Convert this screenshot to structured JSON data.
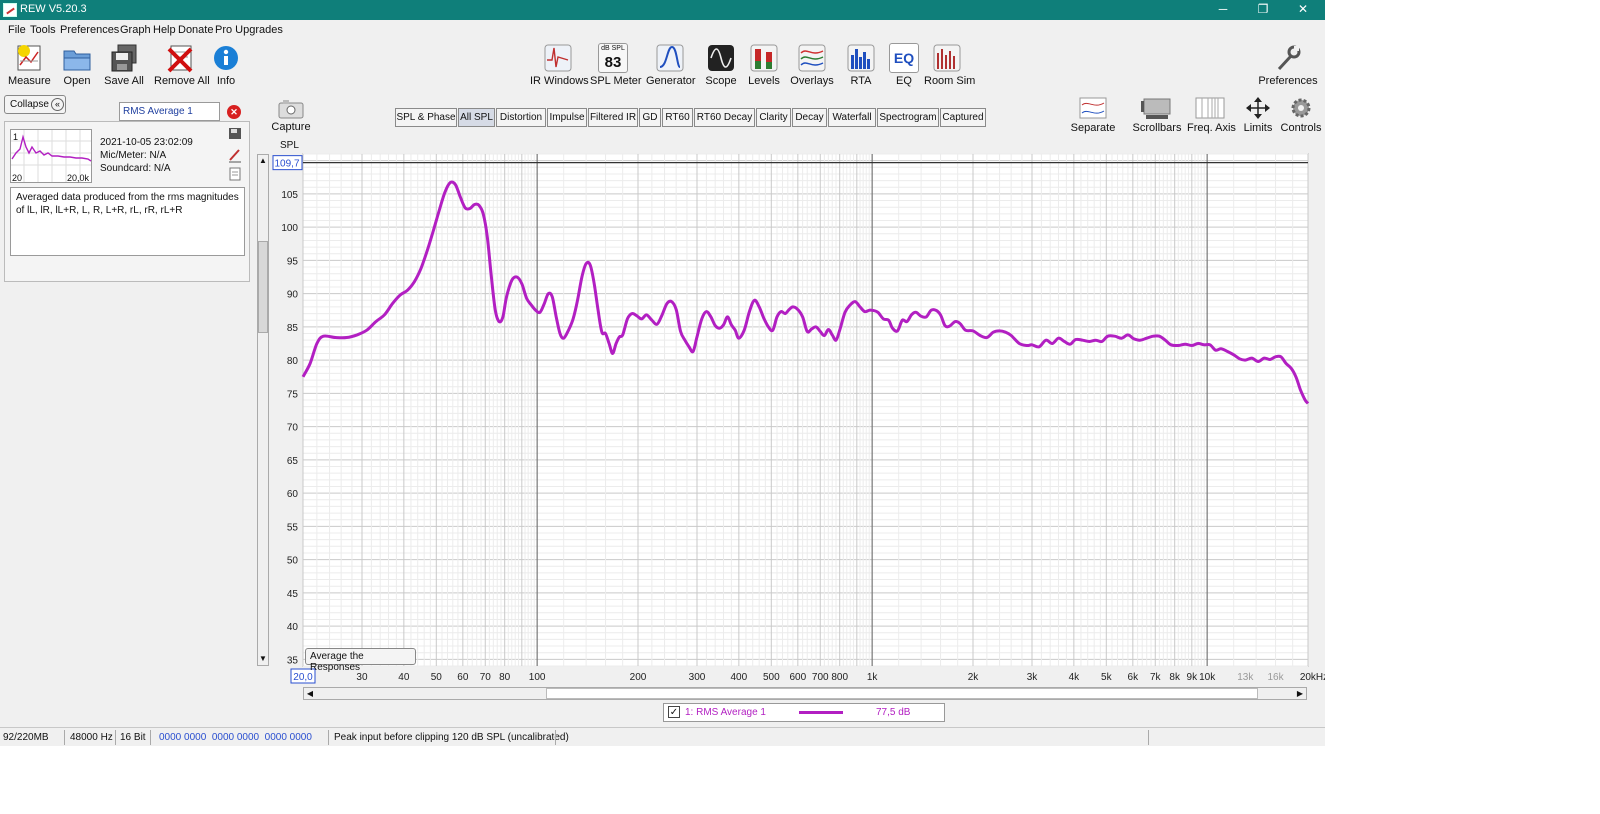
{
  "window": {
    "title": "REW V5.20.3",
    "minimize": "─",
    "restore": "❐",
    "close": "✕"
  },
  "menu": [
    "File",
    "Tools",
    "Preferences",
    "Graph",
    "Help",
    "Donate",
    "Pro Upgrades"
  ],
  "toolbar_left": [
    {
      "label": "Measure",
      "icon": "measure-icon"
    },
    {
      "label": "Open",
      "icon": "folder-icon"
    },
    {
      "label": "Save All",
      "icon": "save-icon"
    },
    {
      "label": "Remove All",
      "icon": "remove-icon"
    },
    {
      "label": "Info",
      "icon": "info-icon"
    }
  ],
  "toolbar_center": [
    {
      "label": "IR Windows",
      "icon": "ir-windows-icon"
    },
    {
      "label": "SPL Meter",
      "icon": "spl-meter-icon",
      "top": "dB SPL",
      "value": "83"
    },
    {
      "label": "Generator",
      "icon": "generator-icon"
    },
    {
      "label": "Scope",
      "icon": "scope-icon"
    },
    {
      "label": "Levels",
      "icon": "levels-icon"
    },
    {
      "label": "Overlays",
      "icon": "overlays-icon"
    },
    {
      "label": "RTA",
      "icon": "rta-icon"
    },
    {
      "label": "EQ",
      "icon": "eq-icon",
      "text": "EQ"
    },
    {
      "label": "Room Sim",
      "icon": "room-sim-icon"
    }
  ],
  "preferences": {
    "label": "Preferences",
    "icon": "wrench-icon"
  },
  "graph_tools": [
    {
      "label": "Separate",
      "icon": "separate-icon"
    },
    {
      "label": "Scrollbars",
      "icon": "scrollbars-icon"
    },
    {
      "label": "Freq. Axis",
      "icon": "freq-axis-icon"
    },
    {
      "label": "Limits",
      "icon": "limits-icon"
    },
    {
      "label": "Controls",
      "icon": "gear-icon"
    }
  ],
  "capture": {
    "label": "Capture",
    "icon": "camera-icon"
  },
  "sidebar": {
    "collapse_label": "Collapse",
    "measurement_name": "RMS Average 1",
    "measurement_number": "1",
    "thumb_min": "20",
    "thumb_max": "20,0k",
    "date": "2021-10-05 23:02:09",
    "mic": "Mic/Meter: N/A",
    "soundcard": "Soundcard: N/A",
    "notes": "Averaged data produced from the rms magnitudes of lL, lR, lL+R, L, R, L+R, rL, rR, rL+R"
  },
  "tabs": [
    "SPL & Phase",
    "All SPL",
    "Distortion",
    "Impulse",
    "Filtered IR",
    "GD",
    "RT60",
    "RT60 Decay",
    "Clarity",
    "Decay",
    "Waterfall",
    "Spectrogram",
    "Captured"
  ],
  "active_tab": "All SPL",
  "average_button": "Average the Responses",
  "legend": {
    "checked": "✓",
    "name": "1: RMS Average 1",
    "value": "77,5 dB",
    "color": "#b21fc2"
  },
  "status": {
    "memory": "92/220MB",
    "rate": "48000 Hz",
    "bits": "16 Bit",
    "bits_vals": "0000 0000  0000 0000  0000 0000",
    "message": "Peak input before clipping 120 dB SPL (uncalibrated)"
  },
  "chart_data": {
    "type": "line",
    "ylabel": "SPL",
    "x_scale": "log",
    "xlim": [
      20,
      20000
    ],
    "ylim": [
      34,
      111
    ],
    "grid": true,
    "cursor_y": 109.7,
    "cursor_y_label": "109,7",
    "cursor_x_label": "20,0",
    "y_ticks": [
      35,
      40,
      45,
      50,
      55,
      60,
      65,
      70,
      75,
      80,
      85,
      90,
      95,
      100,
      105
    ],
    "x_tick_labels": [
      {
        "v": 30,
        "t": "30"
      },
      {
        "v": 40,
        "t": "40"
      },
      {
        "v": 50,
        "t": "50"
      },
      {
        "v": 60,
        "t": "60"
      },
      {
        "v": 70,
        "t": "70"
      },
      {
        "v": 80,
        "t": "80"
      },
      {
        "v": 100,
        "t": "100"
      },
      {
        "v": 200,
        "t": "200"
      },
      {
        "v": 300,
        "t": "300"
      },
      {
        "v": 400,
        "t": "400"
      },
      {
        "v": 500,
        "t": "500"
      },
      {
        "v": 600,
        "t": "600"
      },
      {
        "v": 700,
        "t": "700"
      },
      {
        "v": 800,
        "t": "800"
      },
      {
        "v": 1000,
        "t": "1k"
      },
      {
        "v": 2000,
        "t": "2k"
      },
      {
        "v": 3000,
        "t": "3k"
      },
      {
        "v": 4000,
        "t": "4k"
      },
      {
        "v": 5000,
        "t": "5k"
      },
      {
        "v": 6000,
        "t": "6k"
      },
      {
        "v": 7000,
        "t": "7k"
      },
      {
        "v": 8000,
        "t": "8k"
      },
      {
        "v": 9000,
        "t": "9k"
      },
      {
        "v": 10000,
        "t": "10k"
      },
      {
        "v": 13000,
        "t": "13k"
      },
      {
        "v": 16000,
        "t": "16k"
      },
      {
        "v": 20000,
        "t": "20kHz"
      }
    ],
    "series": [
      {
        "name": "1: RMS Average 1",
        "color": "#b21fc2",
        "points": [
          [
            20,
            77.5
          ],
          [
            21,
            79.5
          ],
          [
            22,
            82.5
          ],
          [
            23,
            83.6
          ],
          [
            25,
            83.4
          ],
          [
            27,
            83.4
          ],
          [
            29,
            83.8
          ],
          [
            31,
            84.5
          ],
          [
            33,
            85.8
          ],
          [
            35,
            86.8
          ],
          [
            37,
            88.5
          ],
          [
            39,
            89.8
          ],
          [
            41,
            90.5
          ],
          [
            43,
            91.8
          ],
          [
            45,
            93.8
          ],
          [
            47,
            96.5
          ],
          [
            49,
            99.5
          ],
          [
            51,
            102.5
          ],
          [
            53,
            105.2
          ],
          [
            55,
            106.7
          ],
          [
            57,
            106.4
          ],
          [
            59,
            104.5
          ],
          [
            61,
            102.9
          ],
          [
            63,
            102.8
          ],
          [
            65,
            103.4
          ],
          [
            67,
            103.3
          ],
          [
            69,
            102
          ],
          [
            71,
            98.5
          ],
          [
            73,
            92.5
          ],
          [
            75,
            87.5
          ],
          [
            77,
            85.8
          ],
          [
            79,
            86.5
          ],
          [
            81,
            89.5
          ],
          [
            84,
            92
          ],
          [
            87,
            92.5
          ],
          [
            90,
            91.5
          ],
          [
            93,
            89.3
          ],
          [
            96,
            88.3
          ],
          [
            99,
            87.5
          ],
          [
            102,
            87.2
          ],
          [
            105,
            88.5
          ],
          [
            108,
            90
          ],
          [
            111,
            89.5
          ],
          [
            114,
            86.5
          ],
          [
            117,
            84
          ],
          [
            120,
            83.3
          ],
          [
            124,
            84.5
          ],
          [
            128,
            86.2
          ],
          [
            132,
            89
          ],
          [
            136,
            92.5
          ],
          [
            140,
            94.5
          ],
          [
            144,
            94.3
          ],
          [
            148,
            91.5
          ],
          [
            152,
            87.5
          ],
          [
            156,
            84.2
          ],
          [
            160,
            84
          ],
          [
            164,
            82.5
          ],
          [
            168,
            81
          ],
          [
            172,
            82.5
          ],
          [
            176,
            83.5
          ],
          [
            180,
            83.8
          ],
          [
            186,
            86.2
          ],
          [
            192,
            87
          ],
          [
            198,
            86.7
          ],
          [
            205,
            86.2
          ],
          [
            212,
            86.8
          ],
          [
            220,
            86
          ],
          [
            228,
            85.4
          ],
          [
            236,
            86.8
          ],
          [
            244,
            88.5
          ],
          [
            252,
            88.8
          ],
          [
            260,
            87.6
          ],
          [
            268,
            84.3
          ],
          [
            276,
            83
          ],
          [
            284,
            82
          ],
          [
            292,
            81.3
          ],
          [
            300,
            83.5
          ],
          [
            310,
            86.2
          ],
          [
            320,
            87.3
          ],
          [
            330,
            86.5
          ],
          [
            340,
            85.2
          ],
          [
            350,
            84.8
          ],
          [
            360,
            85.3
          ],
          [
            370,
            86.5
          ],
          [
            380,
            85.3
          ],
          [
            390,
            84.5
          ],
          [
            400,
            83.3
          ],
          [
            415,
            84.5
          ],
          [
            430,
            87.3
          ],
          [
            445,
            89
          ],
          [
            460,
            88
          ],
          [
            475,
            86.3
          ],
          [
            490,
            85
          ],
          [
            505,
            84.5
          ],
          [
            520,
            86.5
          ],
          [
            535,
            87.3
          ],
          [
            550,
            87
          ],
          [
            565,
            87.6
          ],
          [
            580,
            88
          ],
          [
            600,
            87.6
          ],
          [
            620,
            86.5
          ],
          [
            640,
            84.3
          ],
          [
            660,
            84.7
          ],
          [
            680,
            85
          ],
          [
            700,
            84.3
          ],
          [
            720,
            83.7
          ],
          [
            740,
            84.6
          ],
          [
            760,
            83.8
          ],
          [
            780,
            83
          ],
          [
            800,
            84.5
          ],
          [
            830,
            87.2
          ],
          [
            860,
            88.3
          ],
          [
            890,
            88.8
          ],
          [
            920,
            88
          ],
          [
            950,
            87.3
          ],
          [
            980,
            87.5
          ],
          [
            1000,
            87.5
          ],
          [
            1040,
            87.2
          ],
          [
            1080,
            86.2
          ],
          [
            1120,
            86
          ],
          [
            1150,
            84.8
          ],
          [
            1190,
            84.4
          ],
          [
            1230,
            86
          ],
          [
            1270,
            85.8
          ],
          [
            1310,
            86.8
          ],
          [
            1350,
            87.2
          ],
          [
            1400,
            86.6
          ],
          [
            1450,
            86.5
          ],
          [
            1500,
            87.5
          ],
          [
            1550,
            87.5
          ],
          [
            1600,
            86.8
          ],
          [
            1650,
            85.2
          ],
          [
            1700,
            85.1
          ],
          [
            1770,
            85.8
          ],
          [
            1830,
            85.5
          ],
          [
            1900,
            84.5
          ],
          [
            2000,
            84.4
          ],
          [
            2100,
            83.7
          ],
          [
            2200,
            83.4
          ],
          [
            2300,
            84.2
          ],
          [
            2400,
            84.4
          ],
          [
            2500,
            84.2
          ],
          [
            2600,
            83.7
          ],
          [
            2750,
            82.5
          ],
          [
            2900,
            82.2
          ],
          [
            3000,
            82.3
          ],
          [
            3150,
            82
          ],
          [
            3300,
            83
          ],
          [
            3450,
            82.5
          ],
          [
            3600,
            83.3
          ],
          [
            3750,
            82.8
          ],
          [
            3900,
            82.4
          ],
          [
            4050,
            83.1
          ],
          [
            4250,
            83
          ],
          [
            4450,
            82.8
          ],
          [
            4650,
            83
          ],
          [
            4850,
            82.8
          ],
          [
            5050,
            83.6
          ],
          [
            5300,
            83.6
          ],
          [
            5550,
            83.3
          ],
          [
            5800,
            83.8
          ],
          [
            6050,
            83.2
          ],
          [
            6300,
            83
          ],
          [
            6600,
            83.3
          ],
          [
            6900,
            83.6
          ],
          [
            7200,
            83.6
          ],
          [
            7500,
            83
          ],
          [
            7800,
            82.3
          ],
          [
            8200,
            82.2
          ],
          [
            8600,
            82.4
          ],
          [
            9000,
            82.2
          ],
          [
            9400,
            82.5
          ],
          [
            9800,
            82.3
          ],
          [
            10200,
            82.3
          ],
          [
            10600,
            81.5
          ],
          [
            11000,
            81.7
          ],
          [
            11500,
            81.3
          ],
          [
            12000,
            80.8
          ],
          [
            12500,
            80.2
          ],
          [
            13000,
            80
          ],
          [
            13600,
            80.3
          ],
          [
            14200,
            79.8
          ],
          [
            14800,
            80.3
          ],
          [
            15400,
            80.1
          ],
          [
            16000,
            80.5
          ],
          [
            16600,
            80.5
          ],
          [
            17200,
            79.5
          ],
          [
            17800,
            78.8
          ],
          [
            18400,
            77.5
          ],
          [
            19000,
            75.5
          ],
          [
            19600,
            74
          ],
          [
            20000,
            73.5
          ]
        ]
      }
    ]
  }
}
